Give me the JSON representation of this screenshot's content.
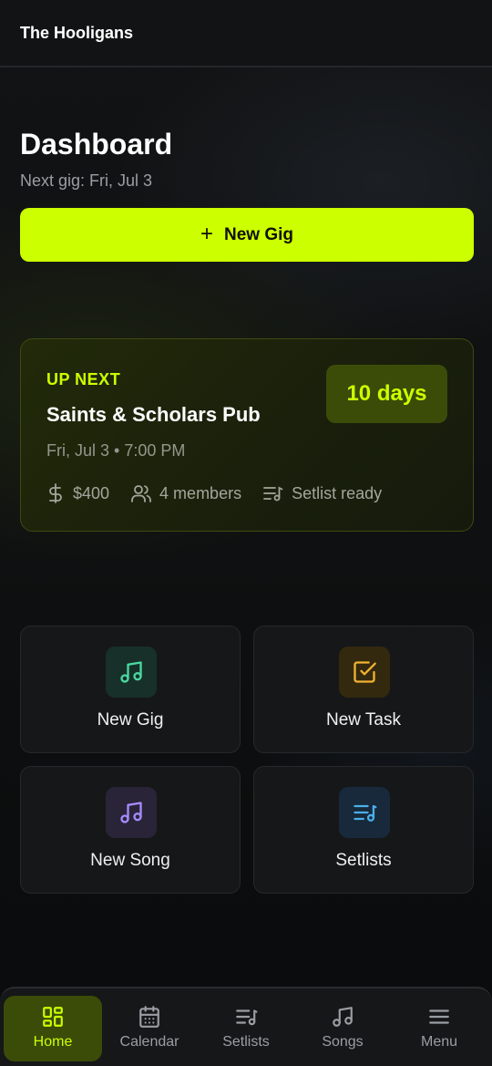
{
  "header": {
    "app_title": "The Hooligans"
  },
  "dashboard": {
    "title": "Dashboard",
    "subtitle": "Next gig: Fri, Jul 3",
    "new_gig_button": {
      "label": "New Gig",
      "icon": "plus-icon"
    }
  },
  "next_gig": {
    "eyebrow": "UP NEXT",
    "venue": "Saints & Scholars Pub",
    "datetime": "Fri, Jul 3 • 7:00 PM",
    "countdown": "10 days",
    "pay": "$400",
    "members": "4 members",
    "setlist_status": "Setlist ready"
  },
  "quick_actions": [
    {
      "label": "New Gig",
      "icon": "music-note-icon",
      "color": "#4ad9a0"
    },
    {
      "label": "New Task",
      "icon": "checkbox-icon",
      "color": "#f2b230"
    },
    {
      "label": "New Song",
      "icon": "music-note-icon",
      "color": "#a58bff"
    },
    {
      "label": "Setlists",
      "icon": "list-music-icon",
      "color": "#4aaeea"
    }
  ],
  "nav": {
    "items": [
      {
        "label": "Home",
        "icon": "grid-icon",
        "active": true
      },
      {
        "label": "Calendar",
        "icon": "calendar-icon"
      },
      {
        "label": "Setlists",
        "icon": "list-music-icon"
      },
      {
        "label": "Songs",
        "icon": "music-note-icon"
      },
      {
        "label": "Menu",
        "icon": "menu-icon"
      }
    ]
  },
  "colors": {
    "accent": "#ccff00",
    "background": "#0b0c0d"
  }
}
